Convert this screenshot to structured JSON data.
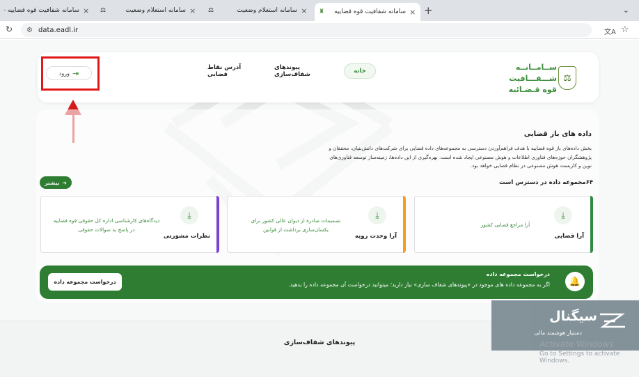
{
  "browser": {
    "tabs": [
      {
        "label": "سامانه شفافیت قوه قضاییه - ‎.ir",
        "close": "×"
      },
      {
        "label": "سامانه استعلام وضعیت",
        "close": "×"
      },
      {
        "label": "سامانه استعلام وضعیت",
        "close": "×"
      },
      {
        "label": "سامانه شفافیت قوه قضاییه",
        "close": "×"
      }
    ],
    "new_tab": "+",
    "tab_menu": "⌄",
    "url": "data.eadl.ir"
  },
  "header": {
    "logo_lines": [
      "ســامــانــه",
      "شـــفـــافیت",
      "قوه قـضـائیه"
    ],
    "nav": {
      "home": "خانه",
      "links": "پیوندهای شفاف‌سازی",
      "addresses": "آدرس نقاط قضایی"
    },
    "login": "ورود"
  },
  "open_data": {
    "title": "داده های باز قضایی",
    "description": "بخش داده‌های باز قوه قضاییه با هدف فراهم‌آوردن دسترسی به مجموعه‌های داده قضایی برای شرکت‌های دانش‌بنیان، محققان و پژوهشگران حوزه‌های فناوری اطلاعات و هوش مصنوعی ایجاد شده است. بهره‌گیری از این داده‌ها، زمینه‌ساز توسعه فناوری‌های نوین و کاربست هوش مصنوعی در نظام قضایی خواهد بود.",
    "more": "بیشتر",
    "count_label": "۶۴مجموعه داده در دسترس است"
  },
  "cards": [
    {
      "title": "آرا قضایی",
      "desc": "آرا مراجع قضایی کشور",
      "accent": "#2e8b3e"
    },
    {
      "title": "آرا وحدت رویه",
      "desc": "تصمیمات صادره از دیوان عالی کشور برای یکسان‌سازی برداشت از قوانین",
      "accent": "#f29d1f"
    },
    {
      "title": "نظرات مشورتی",
      "desc": "دیدگاه‌های کارشناسی اداره کل حقوقی قوه قضاییه در پاسخ به سوالات حقوقی",
      "accent": "#7b3fd4"
    }
  ],
  "request": {
    "title": "درخواست مجموعه داده",
    "desc": "اگر به مجموعه داده های موجود در «پیوندهای شفاف سازی» نیاز دارید؛ میتوانید درخواست آن مجموعه داده را بدهید.",
    "button": "درخواست مجموعه داده"
  },
  "transparency": {
    "title": "پیوندهای شفاف‌سازی"
  },
  "ad": {
    "brand": "سیگنال",
    "tagline": "دستیار هوشمند مالی"
  },
  "windows": {
    "line1": "Activate Windows",
    "line2": "Go to Settings to activate Windows."
  }
}
